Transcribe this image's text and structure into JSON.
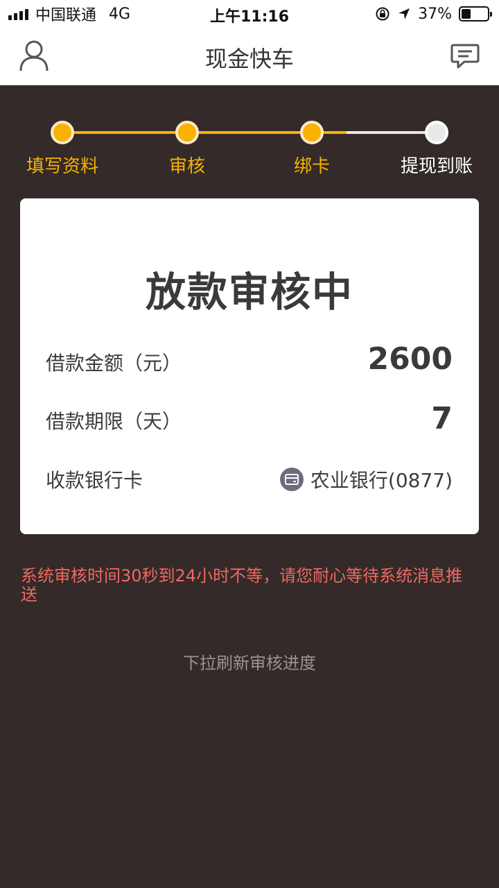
{
  "status_bar": {
    "carrier": "中国联通",
    "network": "4G",
    "time": "上午11:16",
    "battery": "37%",
    "battery_level": 0.37
  },
  "header": {
    "title": "现金快车",
    "left_icon": "user-icon",
    "right_icon": "message-icon"
  },
  "steps": {
    "items": [
      {
        "label": "填写资料",
        "state": "done"
      },
      {
        "label": "审核",
        "state": "done"
      },
      {
        "label": "绑卡",
        "state": "done"
      },
      {
        "label": "提现到账",
        "state": "pending"
      }
    ],
    "active_color": "#f9b200",
    "inactive_color": "#e9e9e9"
  },
  "card": {
    "title": "放款审核中",
    "amount_label": "借款金额（元）",
    "amount_value": "2600",
    "term_label": "借款期限（天）",
    "term_value": "7",
    "bank_label": "收款银行卡",
    "bank_value": "农业银行(0877)",
    "bank_icon": "bank-card-icon"
  },
  "notice": "系统审核时间30秒到24小时不等，请您耐心等待系统消息推送",
  "hint": "下拉刷新审核进度",
  "colors": {
    "background": "#332a29",
    "accent": "#f9b200",
    "notice": "#f06860"
  }
}
